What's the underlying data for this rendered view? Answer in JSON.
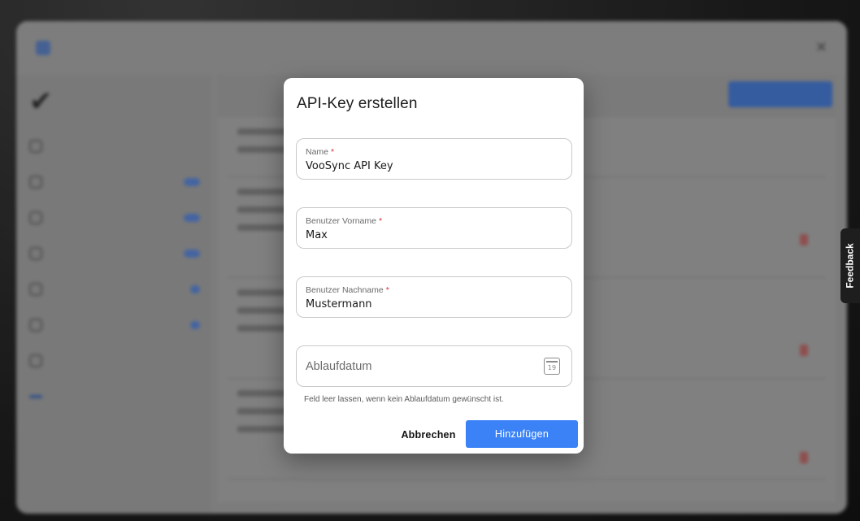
{
  "background_app": {
    "colors": {
      "accent": "#3b82f6",
      "overlay_shade": "#8e8e8e"
    }
  },
  "dialog": {
    "title": "API-Key erstellen",
    "fields": {
      "name": {
        "label": "Name",
        "required_mark": "*",
        "value": "VooSync API Key"
      },
      "first_name": {
        "label": "Benutzer Vorname",
        "required_mark": "*",
        "value": "Max"
      },
      "last_name": {
        "label": "Benutzer Nachname",
        "required_mark": "*",
        "value": "Mustermann"
      },
      "expiry": {
        "placeholder": "Ablaufdatum",
        "icon": "calendar-icon",
        "icon_text": "19"
      }
    },
    "helper_text": "Feld leer lassen, wenn kein Ablaufdatum gewünscht ist.",
    "cancel_label": "Abbrechen",
    "submit_label": "Hinzufügen",
    "colors": {
      "primary": "#3b82f6",
      "required": "#d32f2f"
    }
  },
  "feedback": {
    "label": "Feedback"
  }
}
